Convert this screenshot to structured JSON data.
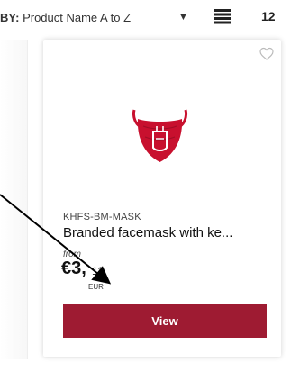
{
  "toolbar": {
    "sort_prefix": "BY:",
    "sort_value": "Product Name A to Z",
    "sort_caret": "▼",
    "items_per_page": "12"
  },
  "product": {
    "sku": "KHFS-BM-MASK",
    "name": "Branded facemask with ke...",
    "from_label": "from",
    "price_whole": "€3,",
    "price_cents": "12",
    "currency": "EUR",
    "view_label": "View"
  },
  "colors": {
    "brand": "#9e1b32",
    "mask": "#c8102e"
  },
  "icons": {
    "list": "list-view-icon",
    "favorite": "heart-outline-icon",
    "sort": "caret-down-icon"
  }
}
